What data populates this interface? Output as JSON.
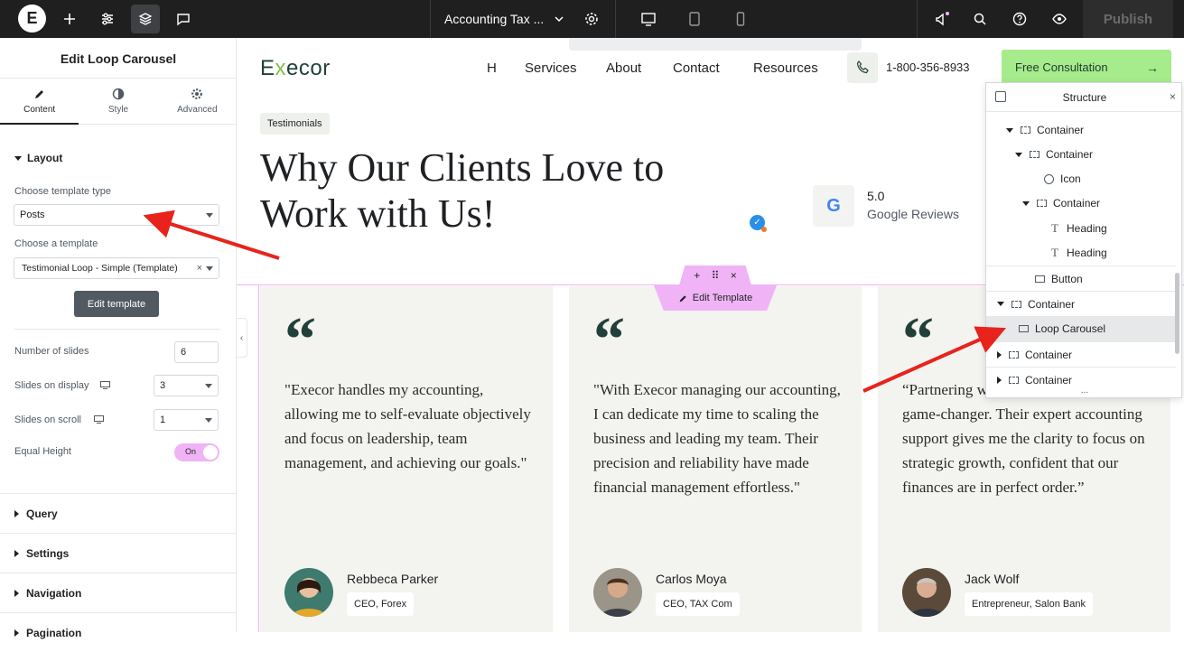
{
  "topbar": {
    "logo_letter": "E",
    "page_title": "Accounting Tax ...",
    "publish_label": "Publish"
  },
  "panel": {
    "title": "Edit Loop Carousel",
    "tabs": [
      {
        "label": "Content",
        "icon": "pencil-icon"
      },
      {
        "label": "Style",
        "icon": "half-circle-icon"
      },
      {
        "label": "Advanced",
        "icon": "gear-icon"
      }
    ],
    "layout_section": "Layout",
    "template_type_label": "Choose template type",
    "template_type_value": "Posts",
    "template_label": "Choose a template",
    "template_value": "Testimonial Loop - Simple (Template)",
    "template_clear": "×",
    "edit_template_btn": "Edit template",
    "slides_label": "Number of slides",
    "slides_value": "6",
    "display_label": "Slides on display",
    "display_value": "3",
    "scroll_label": "Slides on scroll",
    "scroll_value": "1",
    "equal_height_label": "Equal Height",
    "equal_height_value": "On",
    "sections": [
      "Query",
      "Settings",
      "Navigation",
      "Pagination"
    ]
  },
  "site": {
    "logo_pre": "E",
    "logo_x": "x",
    "logo_post": "ecor",
    "nav": [
      "H",
      "Services",
      "About",
      "Contact",
      "Resources"
    ],
    "phone": "1-800-356-8933",
    "cta_label": "Free Consultation",
    "cta_arrow": "→",
    "badge": "Testimonials",
    "headline_1": "Why Our Clients Love to",
    "headline_2": "Work with Us!",
    "google_letter": "G",
    "rating": "5.0",
    "rating_sub": "Google Reviews",
    "edit_template_tab": "Edit Template",
    "toolbar": {
      "add": "+",
      "move": "⠿",
      "close": "×"
    }
  },
  "testimonials": [
    {
      "quote_mark": "“",
      "text": "\"Execor handles my accounting, allowing me to self-evaluate objectively and focus on leadership, team management, and achieving our goals.\"",
      "author": "Rebbeca Parker",
      "role": "CEO, Forex"
    },
    {
      "quote_mark": "“",
      "text": "\"With Execor managing our accounting, I can dedicate my time to scaling the business and leading my team. Their precision and reliability have made financial management effortless.\"",
      "author": "Carlos Moya",
      "role": "CEO, TAX Com"
    },
    {
      "quote_mark": "“",
      "text": "“Partnering with Execor has been a game-changer. Their expert accounting support gives me the clarity to focus on strategic growth, confident that our finances are in perfect order.”",
      "author": "Jack Wolf",
      "role": "Entrepreneur, Salon Bank"
    }
  ],
  "structure": {
    "title": "Structure",
    "close": "×",
    "rows": [
      {
        "label": "Container",
        "icon": "container-icon",
        "arrow": "down"
      },
      {
        "label": "Container",
        "icon": "container-icon",
        "arrow": "down"
      },
      {
        "label": "Icon",
        "icon": "star-icon",
        "arrow": "none"
      },
      {
        "label": "Container",
        "icon": "container-icon",
        "arrow": "down"
      },
      {
        "label": "Heading",
        "icon": "heading-icon",
        "arrow": "none"
      },
      {
        "label": "Heading",
        "icon": "heading-icon",
        "arrow": "none"
      },
      {
        "label": "Button",
        "icon": "button-icon",
        "arrow": "none"
      },
      {
        "label": "Container",
        "icon": "container-icon",
        "arrow": "down"
      },
      {
        "label": "Loop Carousel",
        "icon": "carousel-icon",
        "arrow": "none"
      },
      {
        "label": "Container",
        "icon": "container-icon",
        "arrow": "right"
      },
      {
        "label": "Container",
        "icon": "container-icon",
        "arrow": "right"
      }
    ],
    "more": "..."
  },
  "colors": {
    "accent_pink": "#f0b4f6",
    "cta_green": "#a6eb8c",
    "brand_dark_green": "#21403a",
    "arrow_red": "#e8231c"
  }
}
